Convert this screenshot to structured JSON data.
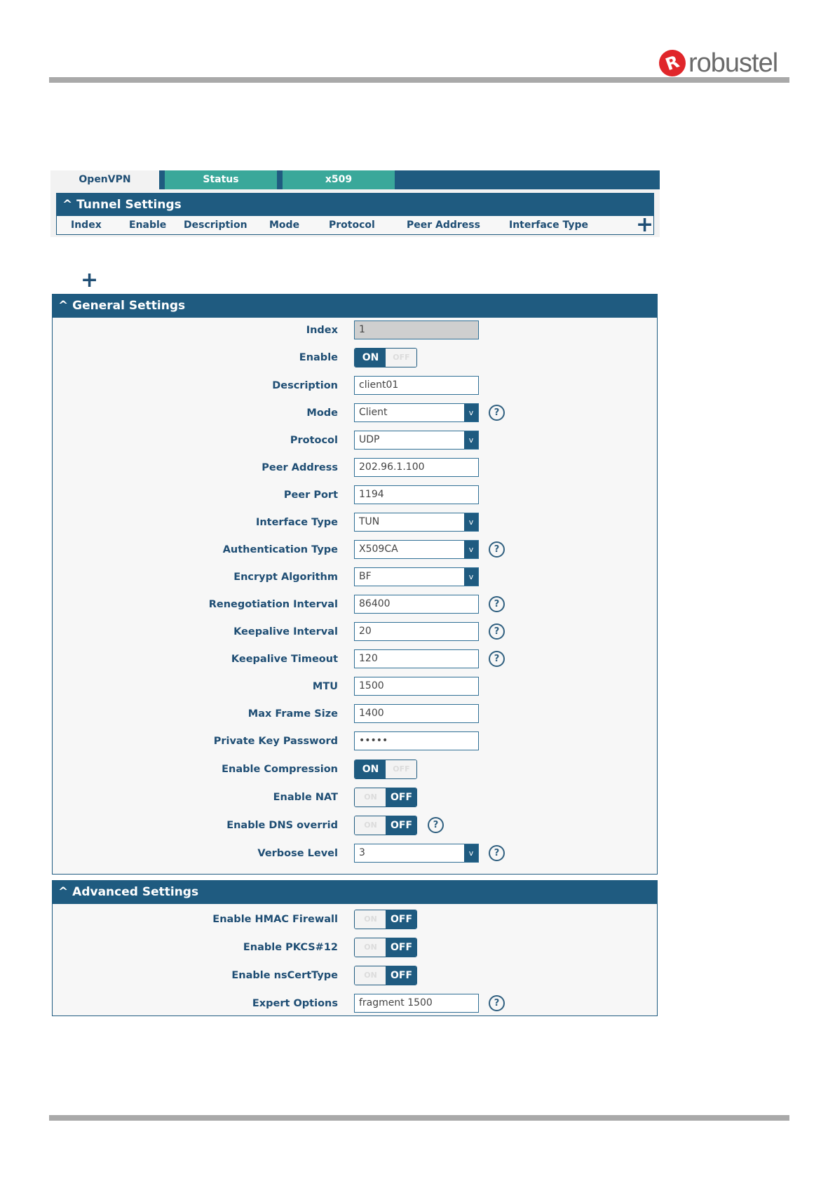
{
  "brand": {
    "logo_mark": "R",
    "logo_text": "robustel",
    "accent_color": "#e0262a"
  },
  "tabs": [
    {
      "label": "OpenVPN",
      "active": true
    },
    {
      "label": "Status",
      "active": false
    },
    {
      "label": "x509",
      "active": false
    }
  ],
  "tunnel_settings": {
    "title": "Tunnel Settings",
    "columns": [
      "Index",
      "Enable",
      "Description",
      "Mode",
      "Protocol",
      "Peer Address",
      "Interface Type"
    ],
    "add_icon": "+"
  },
  "add_button": "+",
  "general": {
    "title": "General Settings",
    "fields": {
      "index": {
        "label": "Index",
        "value": "1"
      },
      "enable": {
        "label": "Enable",
        "state": "ON"
      },
      "description": {
        "label": "Description",
        "value": "client01"
      },
      "mode": {
        "label": "Mode",
        "value": "Client"
      },
      "protocol": {
        "label": "Protocol",
        "value": "UDP"
      },
      "peer_address": {
        "label": "Peer Address",
        "value": "202.96.1.100"
      },
      "peer_port": {
        "label": "Peer Port",
        "value": "1194"
      },
      "interface_type": {
        "label": "Interface Type",
        "value": "TUN"
      },
      "auth_type": {
        "label": "Authentication Type",
        "value": "X509CA"
      },
      "encrypt_algorithm": {
        "label": "Encrypt Algorithm",
        "value": "BF"
      },
      "renegotiation_interval": {
        "label": "Renegotiation Interval",
        "value": "86400"
      },
      "keepalive_interval": {
        "label": "Keepalive Interval",
        "value": "20"
      },
      "keepalive_timeout": {
        "label": "Keepalive Timeout",
        "value": "120"
      },
      "mtu": {
        "label": "MTU",
        "value": "1500"
      },
      "max_frame_size": {
        "label": "Max Frame Size",
        "value": "1400"
      },
      "private_key_password": {
        "label": "Private Key Password",
        "value": "•••••"
      },
      "enable_compression": {
        "label": "Enable Compression",
        "state": "ON"
      },
      "enable_nat": {
        "label": "Enable NAT",
        "state": "OFF"
      },
      "enable_dns_override": {
        "label": "Enable DNS overrid",
        "state": "OFF"
      },
      "verbose_level": {
        "label": "Verbose Level",
        "value": "3"
      }
    }
  },
  "advanced": {
    "title": "Advanced Settings",
    "fields": {
      "enable_hmac_firewall": {
        "label": "Enable HMAC Firewall",
        "state": "OFF"
      },
      "enable_pkcs12": {
        "label": "Enable PKCS#12",
        "state": "OFF"
      },
      "enable_nscerttype": {
        "label": "Enable nsCertType",
        "state": "OFF"
      },
      "expert_options": {
        "label": "Expert Options",
        "value": "fragment 1500"
      }
    }
  },
  "toggle_labels": {
    "on": "ON",
    "off": "OFF"
  },
  "select_arrow": "v",
  "help_glyph": "?",
  "collapse_glyph": "^"
}
